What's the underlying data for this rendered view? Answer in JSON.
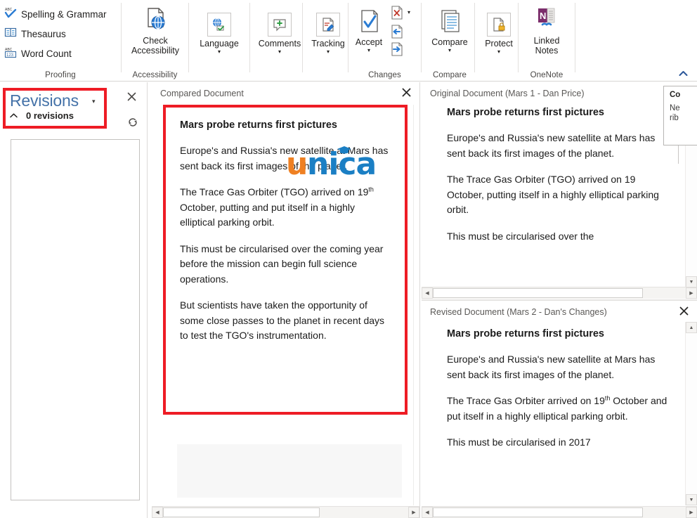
{
  "ribbon": {
    "groups": [
      {
        "name": "proofing",
        "label": "Proofing",
        "commands": [
          {
            "icon": "spelling-grammar-icon",
            "label": "Spelling & Grammar"
          },
          {
            "icon": "thesaurus-icon",
            "label": "Thesaurus"
          },
          {
            "icon": "word-count-icon",
            "label": "Word Count"
          }
        ]
      },
      {
        "name": "accessibility",
        "label": "Accessibility",
        "buttons": [
          {
            "icon": "check-accessibility-icon",
            "label_line1": "Check",
            "label_line2": "Accessibility",
            "caret": false
          }
        ]
      },
      {
        "name": "language",
        "label": "",
        "buttons": [
          {
            "icon": "language-icon",
            "label_line1": "Language",
            "label_line2": "",
            "caret": true
          }
        ]
      },
      {
        "name": "comments",
        "label": "",
        "buttons": [
          {
            "icon": "comments-icon",
            "label_line1": "Comments",
            "label_line2": "",
            "caret": true
          }
        ]
      },
      {
        "name": "tracking",
        "label": "",
        "buttons": [
          {
            "icon": "tracking-icon",
            "label_line1": "Tracking",
            "label_line2": "",
            "caret": true
          }
        ]
      },
      {
        "name": "changes",
        "label": "Changes",
        "buttons": [
          {
            "icon": "accept-icon",
            "label_line1": "Accept",
            "label_line2": "",
            "caret": true
          },
          {
            "icon": "reject-icon",
            "label_line1": "",
            "label_line2": "",
            "caret": true
          },
          {
            "icon": "previous-change-icon",
            "label_line1": "",
            "label_line2": "",
            "caret": false
          },
          {
            "icon": "next-change-icon",
            "label_line1": "",
            "label_line2": "",
            "caret": false
          }
        ]
      },
      {
        "name": "compare",
        "label": "Compare",
        "buttons": [
          {
            "icon": "compare-icon",
            "label_line1": "Compare",
            "label_line2": "",
            "caret": true
          }
        ]
      },
      {
        "name": "protect",
        "label": "",
        "buttons": [
          {
            "icon": "protect-icon",
            "label_line1": "Protect",
            "label_line2": "",
            "caret": true
          }
        ]
      },
      {
        "name": "onenote",
        "label": "OneNote",
        "buttons": [
          {
            "icon": "linked-notes-icon",
            "label_line1": "Linked",
            "label_line2": "Notes",
            "caret": false
          }
        ]
      }
    ],
    "collapse_icon": "chevron-up-icon"
  },
  "revisions_pane": {
    "title": "Revisions",
    "title_caret": "▾",
    "collapse_chevron": "⌃",
    "count_label": "0 revisions",
    "close_icon": "close-icon",
    "refresh_icon": "refresh-icon",
    "highlight_color": "#ee1c25",
    "title_color": "#4472a8"
  },
  "compared_pane": {
    "title": "Compared Document",
    "close_icon": "close-icon",
    "highlight_color": "#ee1c25",
    "document": {
      "heading": "Mars probe returns first pictures",
      "paragraphs": [
        "Europe's and Russia's new satellite at Mars has sent back its first images of the planet.",
        "The Trace Gas Orbiter (TGO) arrived on 19th October, putting and put itself in a highly elliptical parking orbit.",
        "This must be circularised over the coming year before the mission can begin full science operations.",
        "But scientists have taken the opportunity of some close passes to the planet in recent days to test the TGO's instrumentation."
      ],
      "para2_pre": "The Trace Gas Orbiter (TGO) arrived on 19",
      "para2_sup": "th",
      "para2_post": " October, putting and put itself in a highly elliptical parking orbit."
    },
    "hscroll": {
      "left_arrow": "◀",
      "right_arrow": "▶"
    }
  },
  "original_pane": {
    "title": "Original Document (Mars 1 - Dan Price)",
    "document": {
      "heading": "Mars probe returns first pictures",
      "paragraphs": [
        "Europe's and Russia's new satellite at Mars has sent back its first images of the planet.",
        "The Trace Gas Orbiter (TGO) arrived on 19 October, putting itself in a highly elliptical parking orbit.",
        "This must be circularised over the"
      ]
    },
    "vscroll": {
      "down_arrow": "▼"
    },
    "hscroll": {
      "left_arrow": "◀",
      "right_arrow": "▶"
    }
  },
  "revised_pane": {
    "title": "Revised Document (Mars 2 - Dan's Changes)",
    "close_icon": "close-icon",
    "document": {
      "heading": "Mars probe returns first pictures",
      "paragraphs": [
        "Europe's and Russia's new satellite at Mars has sent back its first images of the planet.",
        "The Trace Gas Orbiter arrived on 19th October and put itself in a highly elliptical parking orbit.",
        "This must be circularised in 2017"
      ],
      "para2_pre": "The Trace Gas Orbiter arrived on 19",
      "para2_sup": "th",
      "para2_post": " October and put itself in a highly elliptical parking orbit.",
      "para3": "This must be circularised in 2017"
    },
    "vscroll": {
      "up_arrow": "▲",
      "down_arrow": "▼"
    },
    "hscroll": {
      "left_arrow": "◀",
      "right_arrow": "▶"
    }
  },
  "tooltip": {
    "title_fragment": "Co",
    "body_line1": "Ne",
    "body_line2": "rib"
  },
  "watermark": {
    "text_orange": "u",
    "text_blue": "nica",
    "color_orange": "#ef8022",
    "color_blue": "#1b7fc4",
    "cap_icon": "graduation-cap-icon"
  }
}
